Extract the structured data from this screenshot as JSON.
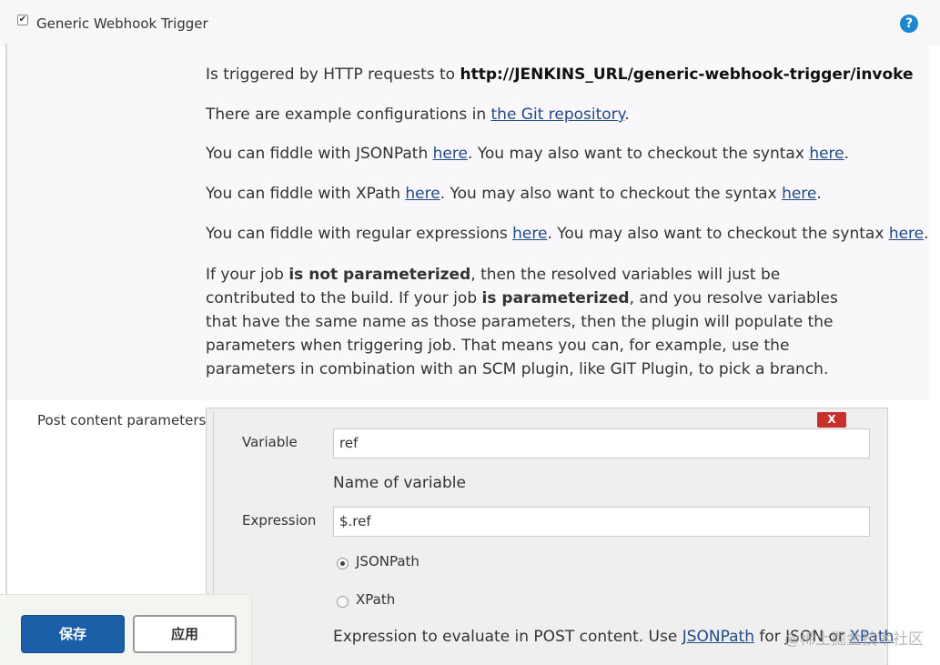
{
  "header": {
    "checkbox_mark": "✔",
    "title": "Generic Webhook Trigger",
    "help_icon": "?"
  },
  "help": {
    "line1_prefix": "Is triggered by HTTP requests to ",
    "line1_url": "http://JENKINS_URL/generic-webhook-trigger/invoke",
    "line2_prefix": "There are example configurations in ",
    "line2_link": "the Git repository",
    "line2_suffix": ".",
    "line3_prefix": "You can fiddle with JSONPath ",
    "line3_link1": "here",
    "line3_mid": ". You may also want to checkout the syntax ",
    "line3_link2": "here",
    "line3_suffix": ".",
    "line4_prefix": "You can fiddle with XPath ",
    "line4_link1": "here",
    "line4_mid": ". You may also want to checkout the syntax ",
    "line4_link2": "here",
    "line4_suffix": ".",
    "line5_prefix": "You can fiddle with regular expressions ",
    "line5_link1": "here",
    "line5_mid": ". You may also want to checkout the syntax ",
    "line5_link2": "here",
    "line5_suffix": ".",
    "para_a": "If your job ",
    "para_b": "is not parameterized",
    "para_c": ", then the resolved variables will just be contributed to the build. If your job ",
    "para_d": "is parameterized",
    "para_e": ", and you resolve variables that have the same name as those parameters, then the plugin will populate the parameters when triggering job. That means you can, for example, use the parameters in combination with an SCM plugin, like GIT Plugin, to pick a branch."
  },
  "post_content": {
    "section_label": "Post content parameters",
    "delete_label": "X",
    "variable_label": "Variable",
    "variable_value": "ref",
    "variable_desc": "Name of variable",
    "expression_label": "Expression",
    "expression_value": "$.ref",
    "radio_jsonpath": "JSONPath",
    "radio_xpath": "XPath",
    "expr_desc_prefix": "Expression to evaluate in POST content. Use ",
    "expr_desc_link1": "JSONPath",
    "expr_desc_mid": " for JSON or ",
    "expr_desc_link2": "XPath"
  },
  "buttons": {
    "save": "保存",
    "apply": "应用"
  },
  "watermark": "@稀土掘金技术社区",
  "colors": {
    "accent_blue": "#1a5fa7",
    "link": "#204a87",
    "delete_red": "#c9302c",
    "help_icon_blue": "#1c86d0"
  }
}
